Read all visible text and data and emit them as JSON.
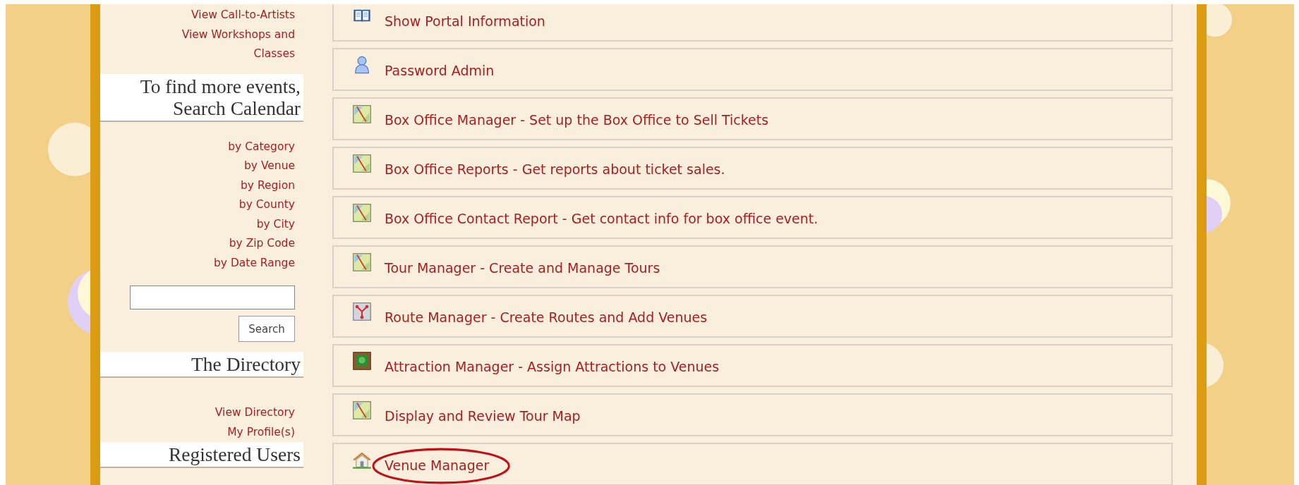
{
  "sidebar": {
    "top_links": [
      "View Call-to-Artists",
      "View Workshops and Classes"
    ],
    "sections": [
      {
        "heading": "To find more events, Search Calendar",
        "links": [
          "by Category",
          "by Venue",
          "by Region",
          "by County",
          "by City",
          "by Zip Code",
          "by Date Range"
        ],
        "search": {
          "button": "Search"
        }
      },
      {
        "heading": "The Directory",
        "links": [
          "View Directory",
          "My Profile(s)"
        ]
      },
      {
        "heading": "Registered Users"
      }
    ]
  },
  "menu": [
    {
      "label": "Show Portal Information",
      "kind": "book",
      "highlighted": false
    },
    {
      "label": "Password Admin",
      "kind": "user",
      "highlighted": false
    },
    {
      "label": "Box Office Manager - Set up the Box Office to Sell Tickets",
      "kind": "map",
      "highlighted": false
    },
    {
      "label": "Box Office Reports - Get reports about ticket sales.",
      "kind": "map",
      "highlighted": false
    },
    {
      "label": "Box Office Contact Report - Get contact info for box office event.",
      "kind": "map",
      "highlighted": false
    },
    {
      "label": "Tour Manager - Create and Manage Tours",
      "kind": "map",
      "highlighted": false
    },
    {
      "label": "Route Manager - Create Routes and Add Venues",
      "kind": "route",
      "highlighted": false
    },
    {
      "label": "Attraction Manager - Assign Attractions to Venues",
      "kind": "picture",
      "highlighted": false
    },
    {
      "label": "Display and Review Tour Map",
      "kind": "map",
      "highlighted": false
    },
    {
      "label": "Venue Manager",
      "kind": "house",
      "highlighted": true
    }
  ]
}
